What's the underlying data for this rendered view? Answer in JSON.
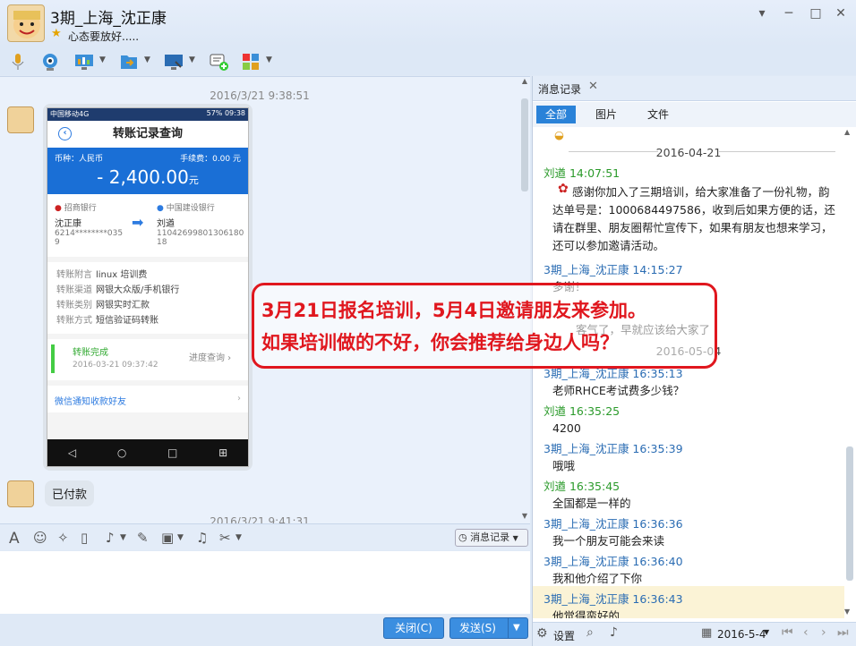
{
  "window": {
    "title": "3期_上海_沈正康",
    "status": "心态要放好.....",
    "controls": [
      "▾",
      "─",
      "□",
      "✕"
    ]
  },
  "chat": {
    "timestamp1": "2016/3/21 9:38:51",
    "timestamp2": "2016/3/21 9:41:31",
    "paid_message": "已付款",
    "phone": {
      "carrier": "中国移动4G",
      "battery": "57%",
      "time": "09:38",
      "header": "转账记录查询",
      "currency_label": "币种：人民币",
      "fee_label": "手续费：0.00 元",
      "amount": "- 2,400.00",
      "amount_unit": "元",
      "from_bank": "招商银行",
      "from_name": "沈正康",
      "from_account": "6214********035 9",
      "to_bank": "中国建设银行",
      "to_name": "刘遒",
      "to_account": "11042699801306180 18",
      "details": [
        {
          "k": "转账附言",
          "v": "linux 培训费"
        },
        {
          "k": "转账渠道",
          "v": "网银大众版/手机银行"
        },
        {
          "k": "转账类别",
          "v": "网银实时汇款"
        },
        {
          "k": "转账方式",
          "v": "短信验证码转账"
        }
      ],
      "done_label": "转账完成",
      "done_time": "2016-03-21 09:37:42",
      "progress_link": "进度查询",
      "wechat_notice": "微信通知收款好友"
    }
  },
  "input": {
    "history_button": "消息记录",
    "close_button": "关闭(C)",
    "send_button": "发送(S)"
  },
  "history": {
    "tab_title": "消息记录",
    "filters": [
      "全部",
      "图片",
      "文件"
    ],
    "entries": [
      {
        "type": "date",
        "text": "2016-04-21"
      },
      {
        "type": "sender",
        "name": "刘遒 14:07:51",
        "color": "green"
      },
      {
        "type": "msg",
        "text": "感谢你加入了三期培训，给大家准备了一份礼物，韵达单号是：1000684497586，收到后如果方便的话，还请在群里、朋友圈帮忙宣传下，如果有朋友也想来学习，还可以参加邀请活动。"
      },
      {
        "type": "sender",
        "name": "3期_上海_沈正康 14:15:27",
        "color": "blue"
      },
      {
        "type": "msg",
        "text": "多谢！"
      },
      {
        "type": "msg",
        "text": "客气了，早就应该给大家了"
      },
      {
        "type": "date",
        "text": "2016-05-04"
      },
      {
        "type": "sender",
        "name": "3期_上海_沈正康 16:35:13",
        "color": "blue"
      },
      {
        "type": "msg",
        "text": "老师RHCE考试费多少钱？"
      },
      {
        "type": "sender",
        "name": "刘遒 16:35:25",
        "color": "green"
      },
      {
        "type": "msg",
        "text": "4200"
      },
      {
        "type": "sender",
        "name": "3期_上海_沈正康 16:35:39",
        "color": "blue"
      },
      {
        "type": "msg",
        "text": "哦哦"
      },
      {
        "type": "sender",
        "name": "刘遒 16:35:45",
        "color": "green"
      },
      {
        "type": "msg",
        "text": "全国都是一样的"
      },
      {
        "type": "sender",
        "name": "3期_上海_沈正康 16:36:36",
        "color": "blue"
      },
      {
        "type": "msg",
        "text": "我一个朋友可能会来读"
      },
      {
        "type": "sender",
        "name": "3期_上海_沈正康 16:36:40",
        "color": "blue"
      },
      {
        "type": "msg",
        "text": "我和他介绍了下你"
      },
      {
        "type": "sender",
        "name": "3期_上海_沈正康 16:36:43",
        "color": "blue"
      },
      {
        "type": "msg",
        "text": "他觉得蛮好的"
      }
    ],
    "settings_label": "设置",
    "date_label": "2016-5-4"
  },
  "annotation": {
    "line1": "3月21日报名培训，5月4日邀请朋友来参加。",
    "line2": "如果培训做的不好，你会推荐给身边人吗？"
  }
}
